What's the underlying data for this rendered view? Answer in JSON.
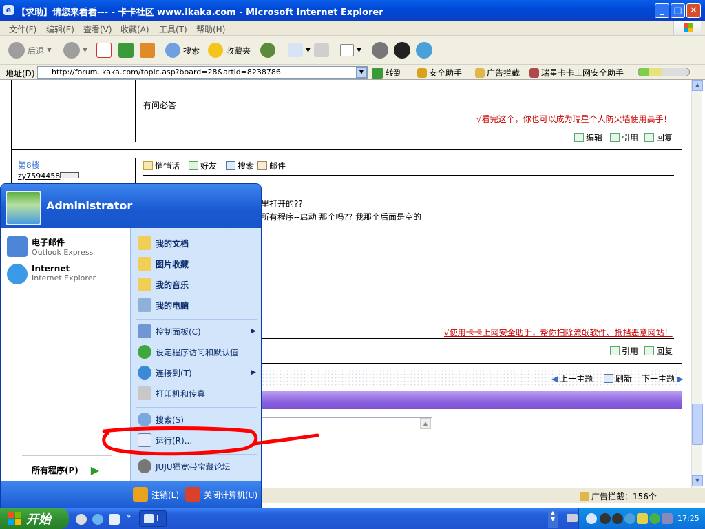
{
  "window": {
    "title": "【求助】请您来看看--- - 卡卡社区 www.ikaka.com - Microsoft Internet Explorer",
    "minimize": "_",
    "maximize": "□",
    "close": "✕"
  },
  "menubar": [
    "文件(F)",
    "编辑(E)",
    "查看(V)",
    "收藏(A)",
    "工具(T)",
    "帮助(H)"
  ],
  "toolbar": {
    "back": "后退",
    "search": "搜索",
    "favorites": "收藏夹"
  },
  "address": {
    "label": "地址(D)",
    "url": "http://forum.ikaka.com/topic.asp?board=28&artid=8238786",
    "go": "转到",
    "links": [
      "安全助手",
      "广告拦截",
      "瑞星卡卡上网安全助手"
    ]
  },
  "post1": {
    "text": "有问必答",
    "signature_link": "√看完这个，你也可以成为瑞星个人防火墙使用高手！",
    "actions": [
      "编辑",
      "引用",
      "回复"
    ]
  },
  "post2": {
    "floor": "第8楼",
    "user": "zy7594458",
    "actions_top": [
      "悄悄话",
      "好友",
      "搜索",
      "邮件"
    ],
    "line1": "里打开的??",
    "line2": "所有程序--启动 那个吗?? 我那个后面是空的",
    "signature_link": "√使用卡卡上网安全助手，帮你扫除流氓软件、抵挡恶意网站！",
    "actions_bottom": [
      "引用",
      "回复"
    ]
  },
  "topic_nav": [
    "上一主题",
    "刷新",
    "下一主题"
  ],
  "statusbar": {
    "adblock": "广告拦截：156个"
  },
  "startmenu": {
    "user": "Administrator",
    "pinned": [
      {
        "title": "电子邮件",
        "sub": "Outlook Express"
      },
      {
        "title": "Internet",
        "sub": "Internet Explorer"
      }
    ],
    "all_programs": "所有程序(P)",
    "places": [
      "我的文档",
      "图片收藏",
      "我的音乐",
      "我的电脑"
    ],
    "settings": [
      "控制面板(C)",
      "设定程序访问和默认值",
      "连接到(T)",
      "打印机和传真"
    ],
    "tools": [
      "搜索(S)",
      "运行(R)...",
      "JUJU猫宽带宝藏论坛"
    ],
    "logoff": "注销(L)",
    "shutdown": "关闭计算机(U)"
  },
  "taskbar": {
    "start": "开始",
    "time": "17:25",
    "task_label": "I"
  },
  "colors": {
    "xp_blue": "#245edb",
    "start_green": "#2f8a2f",
    "link_red": "#cc0000",
    "annotation_red": "#ff0000"
  }
}
